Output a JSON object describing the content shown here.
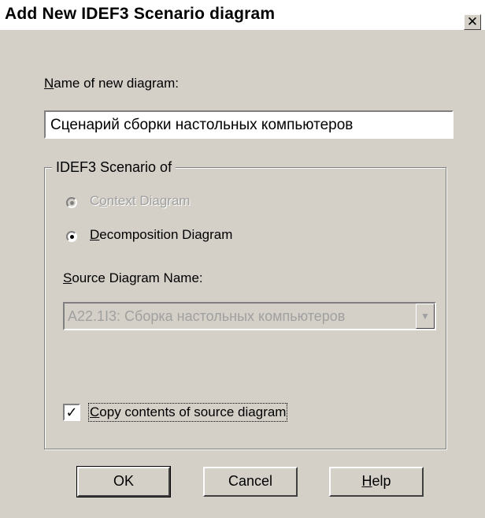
{
  "dialog": {
    "title": "Add New IDEF3 Scenario diagram",
    "close_glyph": "✕"
  },
  "name_field": {
    "label_mnemonic": "N",
    "label_rest": "ame of new diagram:",
    "value": "Сценарий сборки настольных компьютеров"
  },
  "scenario_group": {
    "title": "IDEF3 Scenario of",
    "options": [
      {
        "pre": "C",
        "mnemonic": "o",
        "rest": "ntext Diagram",
        "selected": true,
        "enabled": false
      },
      {
        "pre": "",
        "mnemonic": "D",
        "rest": "ecomposition Diagram",
        "selected": true,
        "enabled": true
      }
    ],
    "source_label_mnemonic": "S",
    "source_label_rest": "ource Diagram Name:",
    "source_value": "A22.1I3:  Сборка настольных компьютеров",
    "copy_contents": {
      "mnemonic": "C",
      "rest": "opy contents of source diagram",
      "checked": true,
      "check_glyph": "✓"
    }
  },
  "buttons": {
    "ok": "OK",
    "cancel": "Cancel",
    "help_mnemonic": "H",
    "help_rest": "elp"
  },
  "icons": {
    "close": "close-icon",
    "dropdown": "chevron-down-icon",
    "check": "checkmark-icon"
  }
}
